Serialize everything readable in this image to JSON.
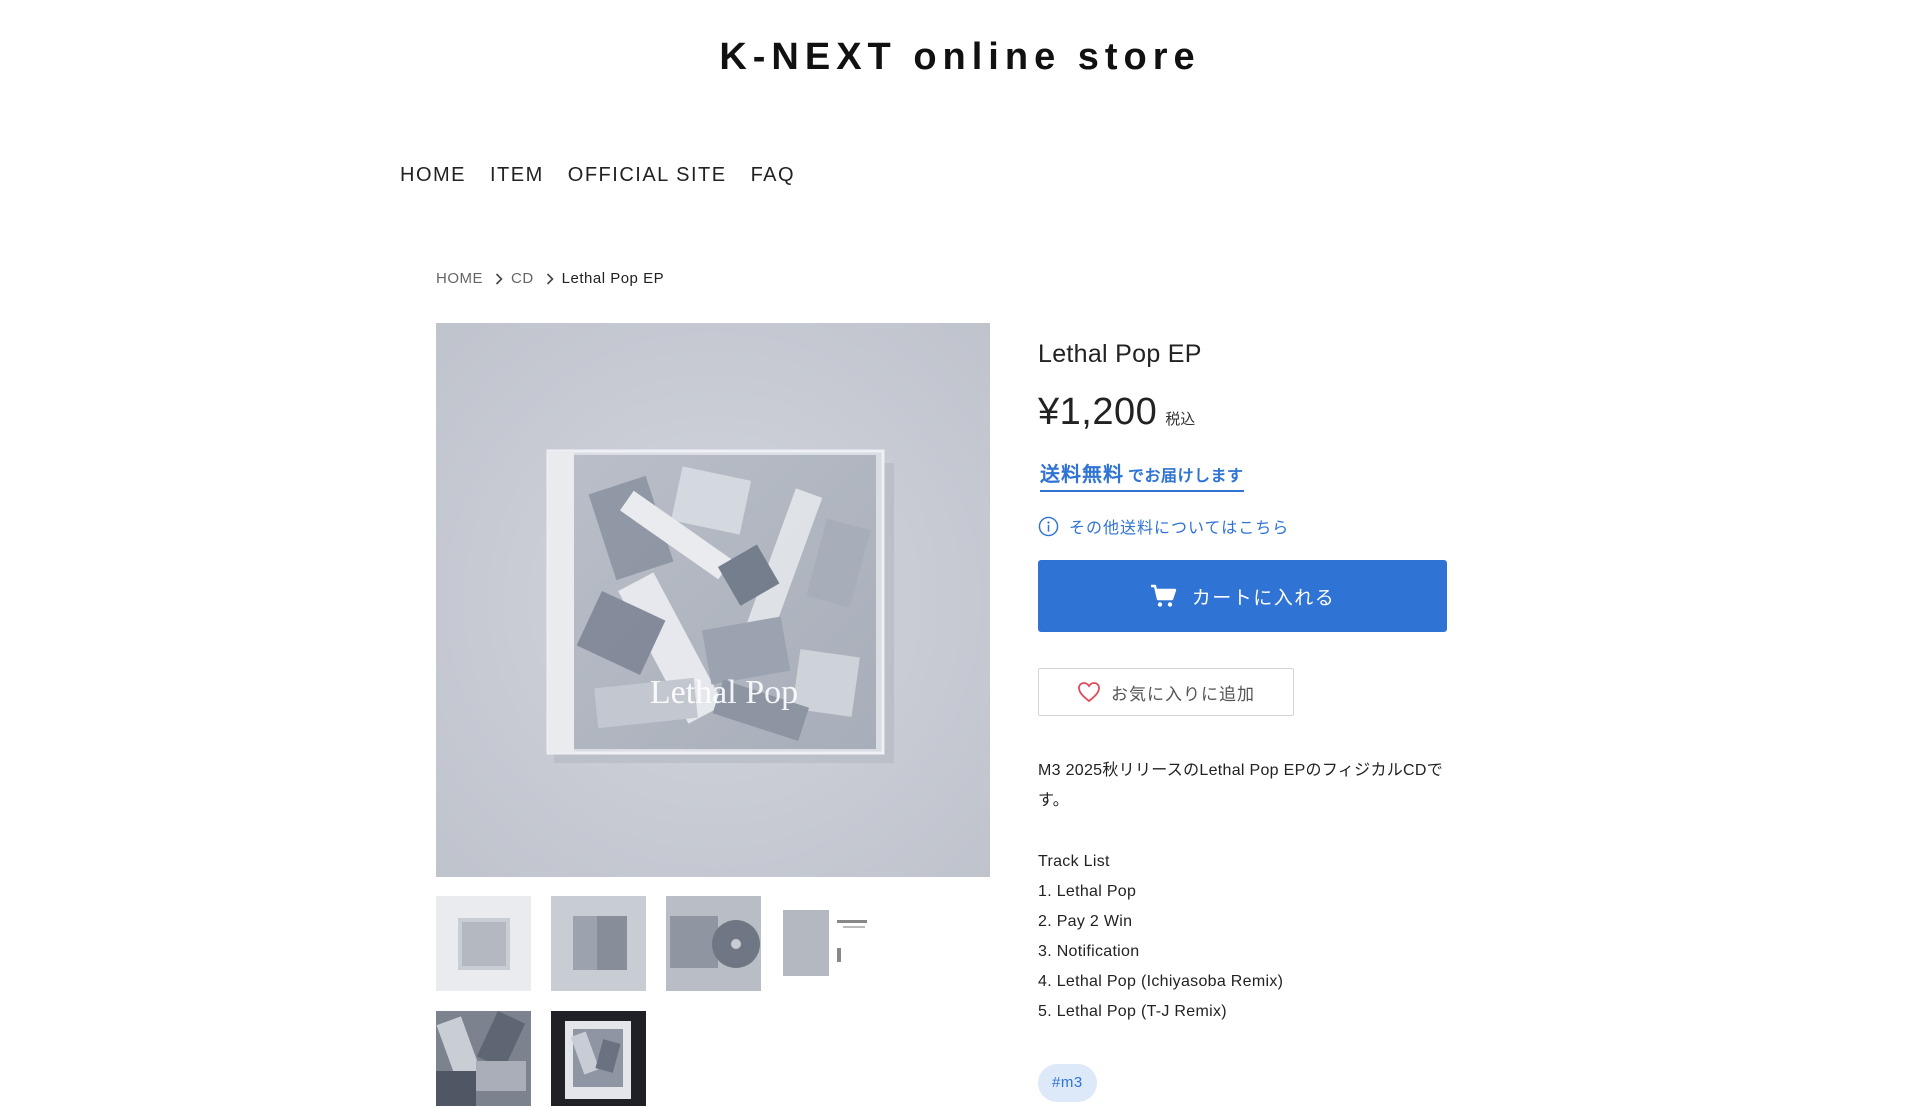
{
  "header": {
    "site_title": "K-NEXT online store"
  },
  "nav": {
    "items": [
      {
        "label": "HOME"
      },
      {
        "label": "ITEM"
      },
      {
        "label": "OFFICIAL SITE"
      },
      {
        "label": "FAQ"
      }
    ]
  },
  "breadcrumb": {
    "home": "HOME",
    "category": "CD",
    "current": "Lethal Pop EP"
  },
  "product": {
    "title": "Lethal Pop EP",
    "price": "¥1,200",
    "tax_note": "税込",
    "free_shipping_big": "送料無料",
    "free_shipping_small": "でお届けします",
    "shipping_link": "その他送料についてはこちら",
    "cart_button": "カートに入れる",
    "favorite_button": "お気に入りに追加",
    "cover_text": "Lethal Pop",
    "description_line1": "M3 2025秋リリースのLethal Pop EPのフィジカルCDで",
    "description_line2": "す。",
    "tracklist_heading": "Track List",
    "tracks": [
      "1. Lethal Pop",
      "2. Pay 2 Win",
      "3. Notification",
      "4. Lethal Pop (Ichiyasoba Remix)",
      "5. Lethal Pop (T-J Remix)"
    ],
    "tag": "#m3"
  },
  "colors": {
    "accent": "#2f73d5",
    "tag_bg": "#dde9f8"
  }
}
